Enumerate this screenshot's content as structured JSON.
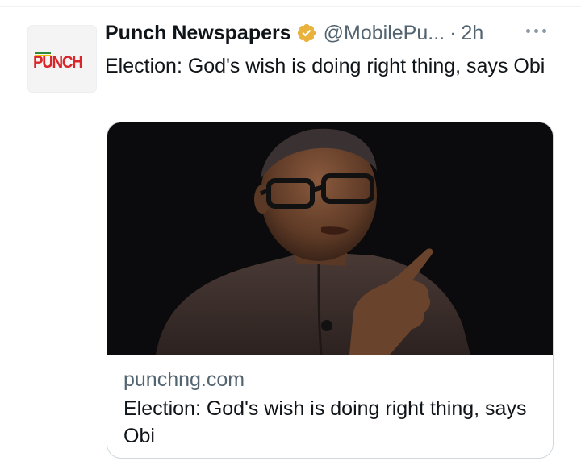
{
  "tweet": {
    "display_name": "Punch Newspapers",
    "handle": "@MobilePu...",
    "separator": "·",
    "timestamp": "2h",
    "text": "Election: God's wish is doing right thing, says Obi",
    "verified_badge_color": "#e8b23c",
    "avatar_logo_text": "PUNCH"
  },
  "card": {
    "domain": "punchng.com",
    "title": "Election: God's wish is doing right thing, says Obi"
  },
  "icons": {
    "verified": "verified-badge-icon",
    "more": "more-options-icon"
  }
}
